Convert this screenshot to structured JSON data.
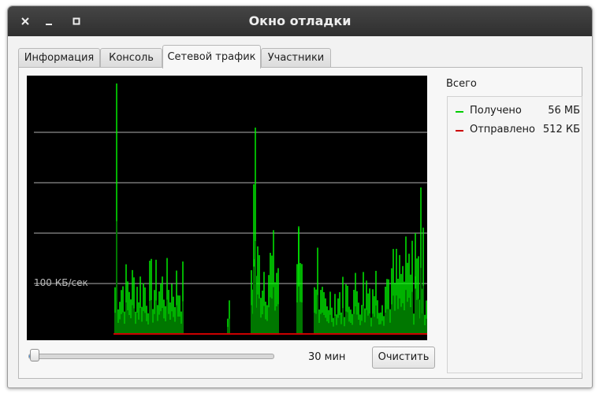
{
  "window": {
    "title": "Окно отладки",
    "buttons": [
      {
        "name": "close-window-button",
        "icon": "close-icon"
      },
      {
        "name": "minimize-window-button",
        "icon": "minimize-icon"
      },
      {
        "name": "maximize-window-button",
        "icon": "maximize-icon"
      }
    ]
  },
  "tabs": [
    {
      "label": "Информация",
      "active": false
    },
    {
      "label": "Консоль",
      "active": false
    },
    {
      "label": "Сетевой трафик",
      "active": true
    },
    {
      "label": "Участники",
      "active": false
    }
  ],
  "graph": {
    "line_label": "100 КБ/сек",
    "background_color": "#000000",
    "grid_color": "#cfcfcf",
    "received_color": "#00ff00",
    "received_fill_color": "#007700",
    "sent_color": "#cc0000"
  },
  "controls": {
    "slider_fraction": 0.02,
    "time_label": "30 мин",
    "clear_label": "Очистить"
  },
  "totals": {
    "title": "Всего",
    "items": [
      {
        "label": "Получено",
        "value": "56 МБ",
        "color": "#00cc00"
      },
      {
        "label": "Отправлено",
        "value": "512 КБ",
        "color": "#cc0000"
      }
    ]
  }
}
